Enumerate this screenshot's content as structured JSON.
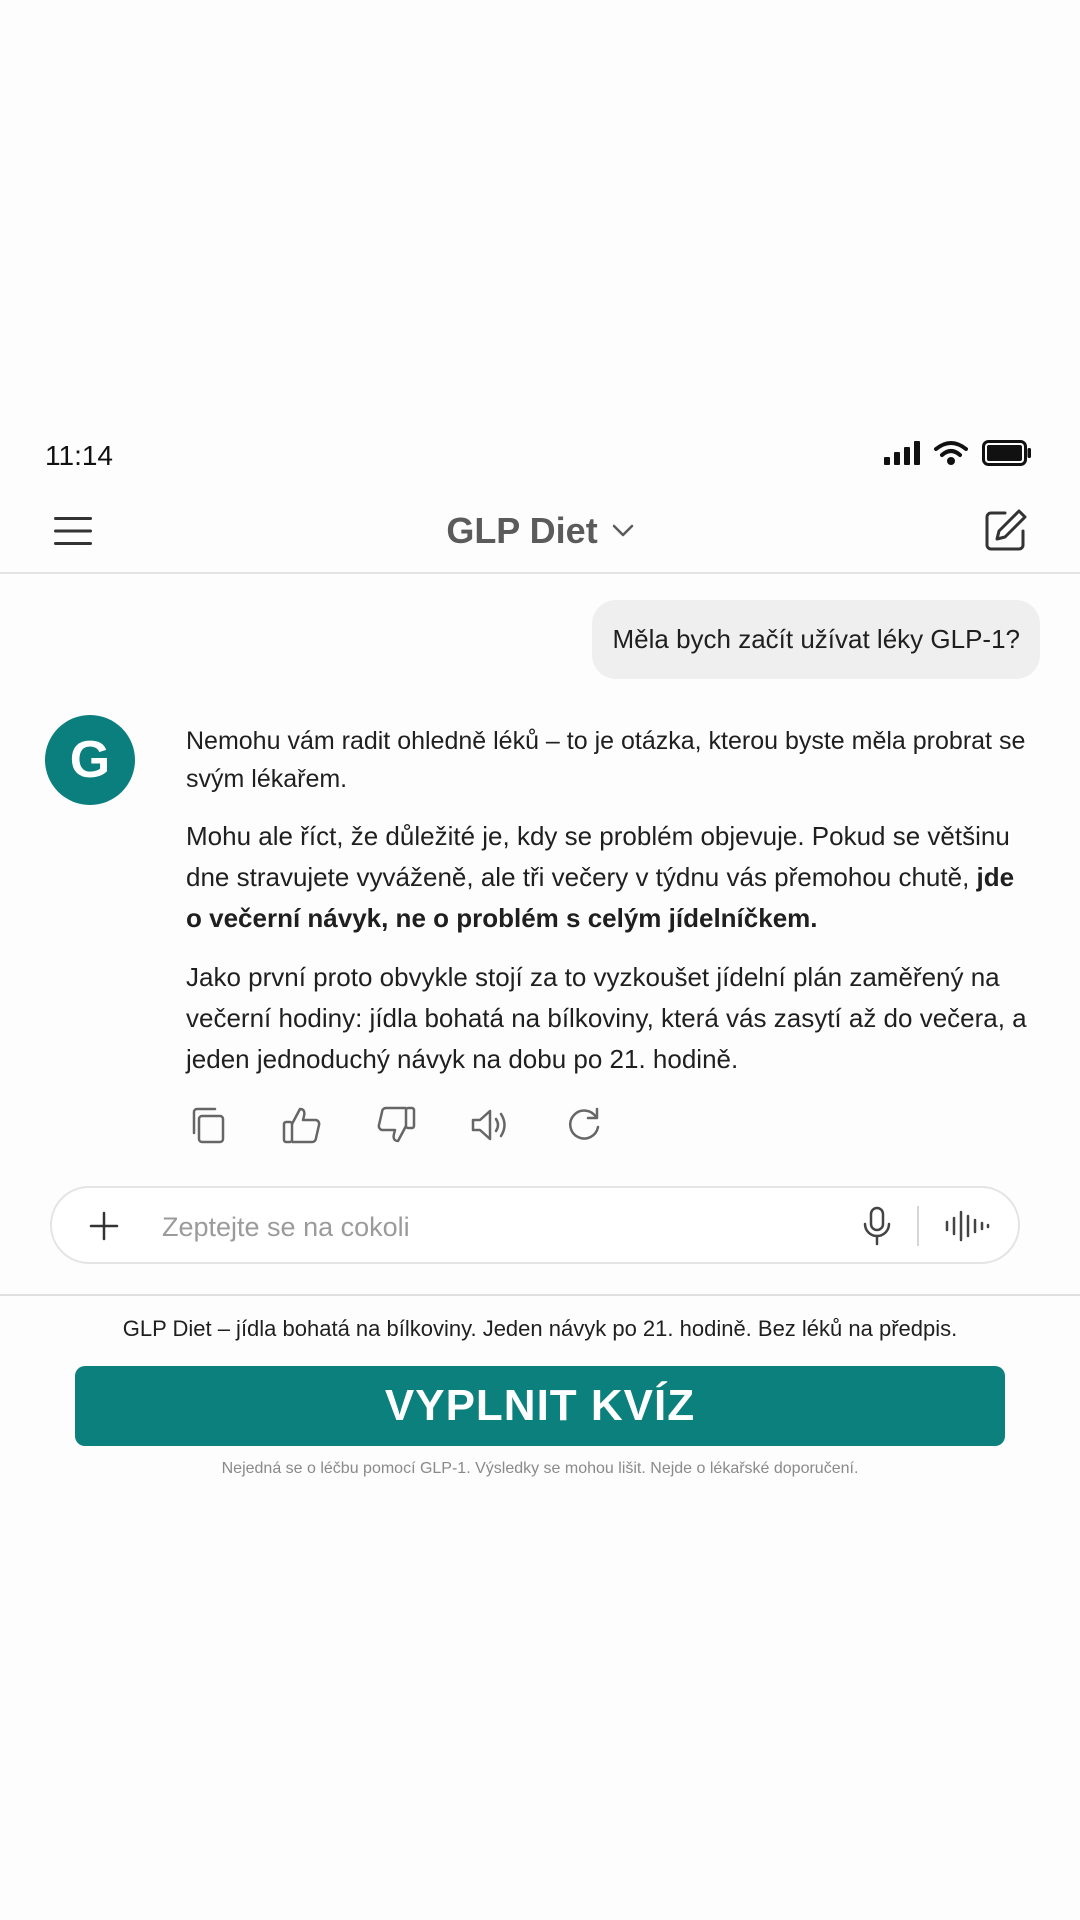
{
  "status_bar": {
    "time": "11:14"
  },
  "header": {
    "title": "GLP Diet"
  },
  "chat": {
    "user_message": "Měla bych začít užívat léky GLP-1?",
    "assistant_avatar_letter": "G",
    "reply": {
      "p1": "Nemohu vám radit ohledně léků – to je otázka, kterou byste měla probrat se svým lékařem.",
      "p2_start": "Mohu ale říct, že důležité je, kdy se problém objevuje. Pokud se většinu dne stravujete vyváženě, ale tři večery v týdnu vás přemohou chutě, ",
      "p2_bold": "jde o večerní návyk, ne o problém s celým jídelníčkem.",
      "p3": "Jako první proto obvykle stojí za to vyzkoušet jídelní plán zaměřený na večerní hodiny: jídla bohatá na bílkoviny, která vás zasytí až do večera, a jeden jednoduchý návyk na dobu po 21. hodině."
    },
    "actions": [
      "copy-icon",
      "thumbs-up-icon",
      "thumbs-down-icon",
      "speaker-icon",
      "regenerate-icon"
    ]
  },
  "composer": {
    "placeholder": "Zeptejte se na cokoli"
  },
  "promo": {
    "text": "GLP Diet – jídla bohatá na bílkoviny. Jeden návyk po 21. hodině. Bez léků na předpis.",
    "cta_label": "VYPLNIT KVÍZ",
    "disclaimer": "Nejedná se o léčbu pomocí GLP-1. Výsledky se mohou lišit. Nejde o lékařské doporučení."
  },
  "colors": {
    "accent": "#0b807d",
    "bubble": "#efefef",
    "title": "#5b5b5b"
  }
}
